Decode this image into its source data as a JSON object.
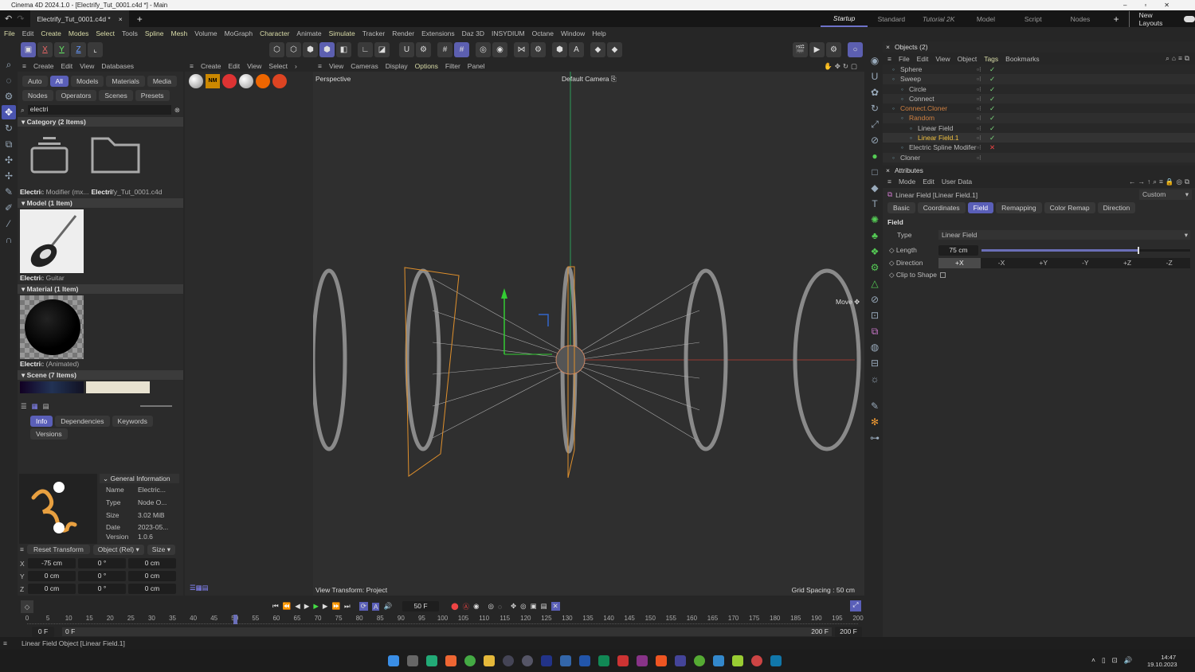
{
  "window": {
    "title": "Cinema 4D 2024.1.0 - [Electrify_Tut_0001.c4d *] - Main"
  },
  "doc_tab": {
    "label": "Electrify_Tut_0001.c4d *",
    "close": "×",
    "add": "+"
  },
  "layouts": {
    "tabs": [
      "Startup",
      "Standard",
      "Tutorial 2K",
      "Model",
      "Script",
      "Nodes"
    ],
    "active": "Startup",
    "add": "+",
    "new_layouts": "New Layouts"
  },
  "menu": [
    "File",
    "Edit",
    "Create",
    "Modes",
    "Select",
    "Tools",
    "Spline",
    "Mesh",
    "Volume",
    "MoGraph",
    "Character",
    "Animate",
    "Simulate",
    "Tracker",
    "Render",
    "Extensions",
    "Daz 3D",
    "INSYDIUM",
    "Octane",
    "Window",
    "Help"
  ],
  "axis_buttons": [
    "X",
    "Y",
    "Z"
  ],
  "asset_browser": {
    "menu": [
      "Create",
      "Edit",
      "View",
      "Databases"
    ],
    "filters_row1": [
      "Auto",
      "All",
      "Models",
      "Materials",
      "Media"
    ],
    "filters_row2": [
      "Nodes",
      "Operators",
      "Scenes",
      "Presets"
    ],
    "active_filter": "All",
    "search_value": "electri",
    "sections": [
      {
        "title": "Category (2 Items)",
        "items": [
          {
            "bold": "Electri",
            "rest": "c Modifier (mx..."
          },
          {
            "bold": "Electri",
            "rest": "fy_Tut_0001.c4d"
          }
        ]
      },
      {
        "title": "Model (1 Item)",
        "items": [
          {
            "bold": "Electri",
            "rest": "c Guitar"
          }
        ]
      },
      {
        "title": "Material (1 Item)",
        "items": [
          {
            "bold": "Electri",
            "rest": "c (Animated)"
          }
        ]
      },
      {
        "title": "Scene (7 Items)",
        "items": []
      }
    ],
    "info_tabs": [
      "Info",
      "Dependencies",
      "Keywords"
    ],
    "versions_tab": "Versions",
    "general_info": {
      "title": "General Information",
      "rows": [
        [
          "Name",
          "Electric..."
        ],
        [
          "Type",
          "Node O..."
        ],
        [
          "Size",
          "3.02 MiB"
        ],
        [
          "Date",
          "2023-05..."
        ],
        [
          "Version",
          "1.0.6"
        ]
      ]
    }
  },
  "coords": {
    "reset": "Reset Transform",
    "mode": "Object (Rel)",
    "size_mode": "Size",
    "rows": [
      [
        "X",
        "-75 cm",
        "0 °",
        "0 cm"
      ],
      [
        "Y",
        "0 cm",
        "0 °",
        "0 cm"
      ],
      [
        "Z",
        "0 cm",
        "0 °",
        "0 cm"
      ]
    ]
  },
  "material_menu": [
    "Create",
    "Edit",
    "View",
    "Select",
    "›"
  ],
  "viewport": {
    "menu": [
      "View",
      "Cameras",
      "Display",
      "Options",
      "Filter",
      "Panel"
    ],
    "active_menu": "Options",
    "label": "Perspective",
    "camera": "Default Camera",
    "transform_label": "View Transform: Project",
    "grid_spacing": "Grid Spacing : 50 cm",
    "tool_hint": "Move"
  },
  "objects": {
    "title": "Objects (2)",
    "menu": [
      "File",
      "Edit",
      "View",
      "Object",
      "Tags",
      "Bookmarks"
    ],
    "rows": [
      {
        "name": "Sphere",
        "indent": 0,
        "color": "#bbbbbb",
        "status": "check"
      },
      {
        "name": "Sweep",
        "indent": 0,
        "color": "#bbbbbb",
        "status": "check"
      },
      {
        "name": "Circle",
        "indent": 1,
        "color": "#bbbbbb",
        "status": "check"
      },
      {
        "name": "Connect",
        "indent": 1,
        "color": "#bbbbbb",
        "status": "check"
      },
      {
        "name": "Connect.Cloner",
        "indent": 0,
        "color": "#d08040",
        "status": "check"
      },
      {
        "name": "Random",
        "indent": 1,
        "color": "#d08040",
        "status": "check"
      },
      {
        "name": "Linear Field",
        "indent": 2,
        "color": "#bbbbbb",
        "status": "check"
      },
      {
        "name": "Linear Field.1",
        "indent": 2,
        "color": "#f0c040",
        "status": "check"
      },
      {
        "name": "Electric Spline Modifer",
        "indent": 1,
        "color": "#bbbbbb",
        "status": "cross"
      },
      {
        "name": "Cloner",
        "indent": 0,
        "color": "#bbbbbb",
        "status": "none"
      }
    ]
  },
  "attributes": {
    "title": "Attributes",
    "menu": [
      "Mode",
      "Edit",
      "User Data"
    ],
    "object": "Linear Field [Linear Field.1]",
    "preset": "Custom",
    "tabs": [
      "Basic",
      "Coordinates",
      "Field",
      "Remapping",
      "Color Remap",
      "Direction"
    ],
    "active_tab": "Field",
    "section": "Field",
    "type_label": "Type",
    "type_value": "Linear Field",
    "length_label": "Length",
    "length_value": "75 cm",
    "length_slider_fraction": 0.75,
    "direction_label": "Direction",
    "directions": [
      "+X",
      "-X",
      "+Y",
      "-Y",
      "+Z",
      "-Z"
    ],
    "direction_active": "+X",
    "clip_label": "Clip to Shape",
    "clip_checked": false
  },
  "timeline": {
    "current_frame": "50 F",
    "ticks": [
      0,
      5,
      10,
      15,
      20,
      25,
      30,
      35,
      40,
      45,
      50,
      55,
      60,
      65,
      70,
      75,
      80,
      85,
      90,
      95,
      100,
      105,
      110,
      115,
      120,
      125,
      130,
      135,
      140,
      145,
      150,
      155,
      160,
      165,
      170,
      175,
      180,
      185,
      190,
      195,
      200
    ],
    "current": 50,
    "max": 200,
    "start_a": "0 F",
    "start_b": "0 F",
    "end_a": "200 F",
    "end_b": "200 F"
  },
  "status": "Linear Field Object [Linear Field.1]",
  "taskbar": {
    "time": "14:47",
    "date": "19.10.2023"
  }
}
